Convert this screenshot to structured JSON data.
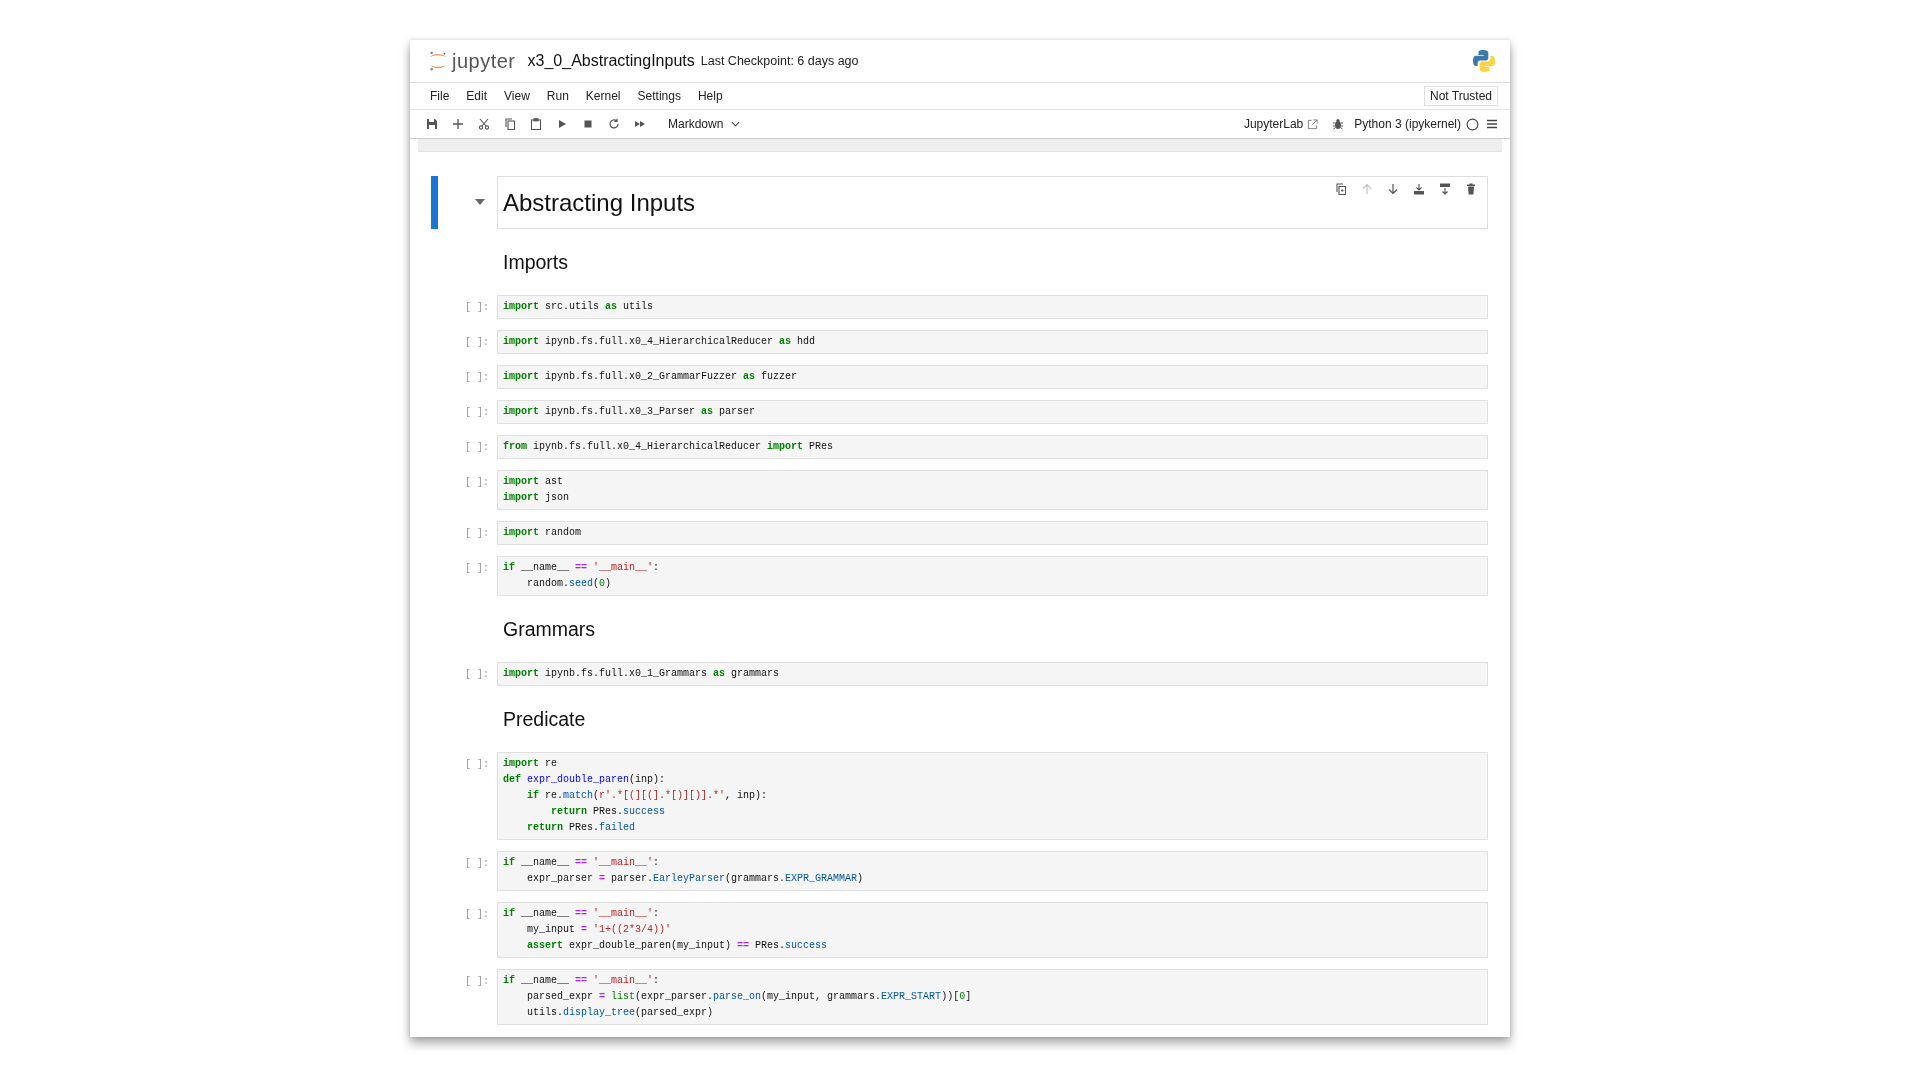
{
  "header": {
    "logo_text": "jupyter",
    "title": "x3_0_AbstractingInputs",
    "checkpoint": "Last Checkpoint: 6 days ago"
  },
  "menu": [
    "File",
    "Edit",
    "View",
    "Run",
    "Kernel",
    "Settings",
    "Help"
  ],
  "trust": "Not Trusted",
  "toolbar": {
    "cell_type": "Markdown",
    "open_in": "JupyterLab",
    "kernel": {
      "name": "Python 3 (ipykernel)",
      "busy": false
    }
  },
  "cell_toolbar": [
    {
      "kind": "duplicate",
      "disabled": false
    },
    {
      "kind": "move-up",
      "disabled": true
    },
    {
      "kind": "move-down",
      "disabled": false
    },
    {
      "kind": "insert-above",
      "disabled": false
    },
    {
      "kind": "insert-below",
      "disabled": false
    },
    {
      "kind": "delete",
      "disabled": false
    }
  ],
  "cells": [
    {
      "kind": "h1",
      "selected": true,
      "text": "Abstracting Inputs"
    },
    {
      "kind": "h2",
      "selected": false,
      "text": "Imports"
    },
    {
      "kind": "code",
      "selected": false,
      "prompt": "[ ]:",
      "lines": [
        [
          {
            "kind": "kw",
            "text": "import"
          },
          {
            "kind": "plain",
            "text": " src.utils "
          },
          {
            "kind": "kw",
            "text": "as"
          },
          {
            "kind": "plain",
            "text": " utils"
          }
        ]
      ]
    },
    {
      "kind": "code",
      "selected": false,
      "prompt": "[ ]:",
      "lines": [
        [
          {
            "kind": "kw",
            "text": "import"
          },
          {
            "kind": "plain",
            "text": " ipynb.fs.full.x0_4_HierarchicalReducer "
          },
          {
            "kind": "kw",
            "text": "as"
          },
          {
            "kind": "plain",
            "text": " hdd"
          }
        ]
      ]
    },
    {
      "kind": "code",
      "selected": false,
      "prompt": "[ ]:",
      "lines": [
        [
          {
            "kind": "kw",
            "text": "import"
          },
          {
            "kind": "plain",
            "text": " ipynb.fs.full.x0_2_GrammarFuzzer "
          },
          {
            "kind": "kw",
            "text": "as"
          },
          {
            "kind": "plain",
            "text": " fuzzer"
          }
        ]
      ]
    },
    {
      "kind": "code",
      "selected": false,
      "prompt": "[ ]:",
      "lines": [
        [
          {
            "kind": "kw",
            "text": "import"
          },
          {
            "kind": "plain",
            "text": " ipynb.fs.full.x0_3_Parser "
          },
          {
            "kind": "kw",
            "text": "as"
          },
          {
            "kind": "plain",
            "text": " parser"
          }
        ]
      ]
    },
    {
      "kind": "code",
      "selected": false,
      "prompt": "[ ]:",
      "lines": [
        [
          {
            "kind": "kw",
            "text": "from"
          },
          {
            "kind": "plain",
            "text": " ipynb.fs.full.x0_4_HierarchicalReducer "
          },
          {
            "kind": "kw",
            "text": "import"
          },
          {
            "kind": "plain",
            "text": " PRes"
          }
        ]
      ]
    },
    {
      "kind": "code",
      "selected": false,
      "prompt": "[ ]:",
      "lines": [
        [
          {
            "kind": "kw",
            "text": "import"
          },
          {
            "kind": "plain",
            "text": " ast"
          }
        ],
        [
          {
            "kind": "kw",
            "text": "import"
          },
          {
            "kind": "plain",
            "text": " json"
          }
        ]
      ]
    },
    {
      "kind": "code",
      "selected": false,
      "prompt": "[ ]:",
      "lines": [
        [
          {
            "kind": "kw",
            "text": "import"
          },
          {
            "kind": "plain",
            "text": " random"
          }
        ]
      ]
    },
    {
      "kind": "code",
      "selected": false,
      "prompt": "[ ]:",
      "lines": [
        [
          {
            "kind": "kw",
            "text": "if"
          },
          {
            "kind": "plain",
            "text": " __name__ "
          },
          {
            "kind": "op",
            "text": "=="
          },
          {
            "kind": "str",
            "text": " '__main__'"
          },
          {
            "kind": "plain",
            "text": ":"
          }
        ],
        [
          {
            "kind": "plain",
            "text": "    random."
          },
          {
            "kind": "prop",
            "text": "seed"
          },
          {
            "kind": "plain",
            "text": "("
          },
          {
            "kind": "num",
            "text": "0"
          },
          {
            "kind": "plain",
            "text": ")"
          }
        ]
      ]
    },
    {
      "kind": "h2",
      "selected": false,
      "text": "Grammars"
    },
    {
      "kind": "code",
      "selected": false,
      "prompt": "[ ]:",
      "lines": [
        [
          {
            "kind": "kw",
            "text": "import"
          },
          {
            "kind": "plain",
            "text": " ipynb.fs.full.x0_1_Grammars "
          },
          {
            "kind": "kw",
            "text": "as"
          },
          {
            "kind": "plain",
            "text": " grammars"
          }
        ]
      ]
    },
    {
      "kind": "h2",
      "selected": false,
      "text": "Predicate"
    },
    {
      "kind": "code",
      "selected": false,
      "prompt": "[ ]:",
      "lines": [
        [
          {
            "kind": "kw",
            "text": "import"
          },
          {
            "kind": "plain",
            "text": " re"
          }
        ],
        [
          {
            "kind": "kw",
            "text": "def"
          },
          {
            "kind": "def",
            "text": " expr_double_paren"
          },
          {
            "kind": "plain",
            "text": "(inp):"
          }
        ],
        [
          {
            "kind": "kw",
            "text": "    if"
          },
          {
            "kind": "plain",
            "text": " re."
          },
          {
            "kind": "prop",
            "text": "match"
          },
          {
            "kind": "plain",
            "text": "("
          },
          {
            "kind": "str",
            "text": "r'.*[(][(].*[)][)].*'"
          },
          {
            "kind": "plain",
            "text": ", inp):"
          }
        ],
        [
          {
            "kind": "kw",
            "text": "        return"
          },
          {
            "kind": "plain",
            "text": " PRes."
          },
          {
            "kind": "prop",
            "text": "success"
          }
        ],
        [
          {
            "kind": "kw",
            "text": "    return"
          },
          {
            "kind": "plain",
            "text": " PRes."
          },
          {
            "kind": "prop",
            "text": "failed"
          }
        ]
      ]
    },
    {
      "kind": "code",
      "selected": false,
      "prompt": "[ ]:",
      "lines": [
        [
          {
            "kind": "kw",
            "text": "if"
          },
          {
            "kind": "plain",
            "text": " __name__ "
          },
          {
            "kind": "op",
            "text": "=="
          },
          {
            "kind": "str",
            "text": " '__main__'"
          },
          {
            "kind": "plain",
            "text": ":"
          }
        ],
        [
          {
            "kind": "plain",
            "text": "    expr_parser "
          },
          {
            "kind": "op",
            "text": "="
          },
          {
            "kind": "plain",
            "text": " parser."
          },
          {
            "kind": "prop",
            "text": "EarleyParser"
          },
          {
            "kind": "plain",
            "text": "(grammars."
          },
          {
            "kind": "prop",
            "text": "EXPR_GRAMMAR"
          },
          {
            "kind": "plain",
            "text": ")"
          }
        ]
      ]
    },
    {
      "kind": "code",
      "selected": false,
      "prompt": "[ ]:",
      "lines": [
        [
          {
            "kind": "kw",
            "text": "if"
          },
          {
            "kind": "plain",
            "text": " __name__ "
          },
          {
            "kind": "op",
            "text": "=="
          },
          {
            "kind": "str",
            "text": " '__main__'"
          },
          {
            "kind": "plain",
            "text": ":"
          }
        ],
        [
          {
            "kind": "plain",
            "text": "    my_input "
          },
          {
            "kind": "op",
            "text": "="
          },
          {
            "kind": "str",
            "text": " '1+((2*3/4))'"
          }
        ],
        [
          {
            "kind": "kw",
            "text": "    assert"
          },
          {
            "kind": "plain",
            "text": " expr_double_paren(my_input) "
          },
          {
            "kind": "op",
            "text": "=="
          },
          {
            "kind": "plain",
            "text": " PRes."
          },
          {
            "kind": "prop",
            "text": "success"
          }
        ]
      ]
    },
    {
      "kind": "code",
      "selected": false,
      "prompt": "[ ]:",
      "lines": [
        [
          {
            "kind": "kw",
            "text": "if"
          },
          {
            "kind": "plain",
            "text": " __name__ "
          },
          {
            "kind": "op",
            "text": "=="
          },
          {
            "kind": "str",
            "text": " '__main__'"
          },
          {
            "kind": "plain",
            "text": ":"
          }
        ],
        [
          {
            "kind": "plain",
            "text": "    parsed_expr "
          },
          {
            "kind": "op",
            "text": "="
          },
          {
            "kind": "builtin",
            "text": " list"
          },
          {
            "kind": "plain",
            "text": "(expr_parser."
          },
          {
            "kind": "prop",
            "text": "parse_on"
          },
          {
            "kind": "plain",
            "text": "(my_input, grammars."
          },
          {
            "kind": "prop",
            "text": "EXPR_START"
          },
          {
            "kind": "plain",
            "text": "))["
          },
          {
            "kind": "num",
            "text": "0"
          },
          {
            "kind": "plain",
            "text": "]"
          }
        ],
        [
          {
            "kind": "plain",
            "text": "    utils."
          },
          {
            "kind": "prop",
            "text": "display_tree"
          },
          {
            "kind": "plain",
            "text": "(parsed_expr)"
          }
        ]
      ]
    }
  ]
}
